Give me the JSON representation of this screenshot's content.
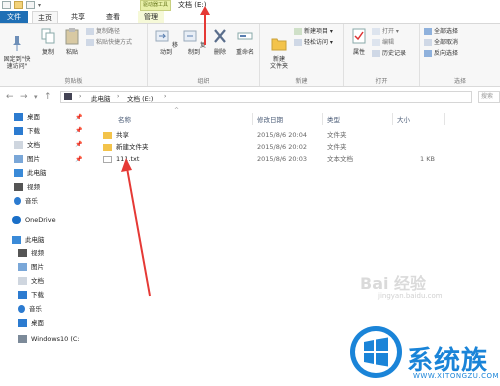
{
  "title_bar": {
    "context_group": "驱动器工具",
    "window_title": "文档 (E:)"
  },
  "tabs": {
    "file": "文件",
    "home": "主页",
    "share": "共享",
    "view": "查看",
    "manage": "管理"
  },
  "ribbon": {
    "clipboard": {
      "label": "剪贴板",
      "pin": "固定到\"快\n速访问\"",
      "copy": "复制",
      "paste": "粘贴",
      "copy_path": "复制路径",
      "paste_shortcut": "粘贴快捷方式"
    },
    "organize": {
      "label": "组织",
      "move_to": "移动到",
      "copy_to": "复制到",
      "delete": "删除",
      "rename": "重命名"
    },
    "new": {
      "label": "新建",
      "new_folder": "新建\n文件夹",
      "new_item": "新建项目",
      "easy_access": "轻松访问"
    },
    "open": {
      "label": "打开",
      "properties": "属性",
      "open": "打开",
      "edit": "编辑",
      "history": "历史记录"
    },
    "select": {
      "label": "选择",
      "select_all": "全部选择",
      "select_none": "全部取消",
      "invert": "反向选择"
    }
  },
  "address": {
    "this_pc": "此电脑",
    "current": "文档 (E:)",
    "search_placeholder": "搜索"
  },
  "nav_pane": {
    "items": [
      {
        "label": "桌面",
        "icon": "desktop-icon"
      },
      {
        "label": "下载",
        "icon": "download-icon"
      },
      {
        "label": "文档",
        "icon": "documents-icon"
      },
      {
        "label": "图片",
        "icon": "pictures-icon"
      },
      {
        "label": "此电脑",
        "icon": "computer-icon"
      },
      {
        "label": "视频",
        "icon": "video-icon"
      },
      {
        "label": "音乐",
        "icon": "music-icon"
      },
      {
        "label": "OneDrive",
        "icon": "onedrive-icon"
      },
      {
        "label": "此电脑",
        "icon": "computer-icon"
      },
      {
        "label": "视频",
        "icon": "video-icon"
      },
      {
        "label": "图片",
        "icon": "pictures-icon"
      },
      {
        "label": "文档",
        "icon": "documents-icon"
      },
      {
        "label": "下载",
        "icon": "download-icon"
      },
      {
        "label": "音乐",
        "icon": "music-icon"
      },
      {
        "label": "桌面",
        "icon": "desktop-icon"
      },
      {
        "label": "Windows10 (C:",
        "icon": "drive-icon"
      }
    ]
  },
  "file_list": {
    "headers": {
      "name": "名称",
      "date": "修改日期",
      "type": "类型",
      "size": "大小"
    },
    "rows": [
      {
        "name": "共享",
        "date": "2015/8/6 20:04",
        "type": "文件夹",
        "size": "",
        "icon": "folder-icon"
      },
      {
        "name": "新建文件夹",
        "date": "2015/8/6 20:02",
        "type": "文件夹",
        "size": "",
        "icon": "folder-icon"
      },
      {
        "name": "111.txt",
        "date": "2015/8/6 20:03",
        "type": "文本文档",
        "size": "1 KB",
        "icon": "text-file-icon"
      }
    ]
  },
  "watermark": {
    "baidu": "Bai 经验",
    "url": "jingyan.baidu.com"
  },
  "logo": {
    "text": "系统族",
    "url": "WWW.XITONGZU.COM"
  },
  "colors": {
    "accent": "#1f6fb5",
    "arrow": "#e53935",
    "folder": "#f3c34a"
  }
}
